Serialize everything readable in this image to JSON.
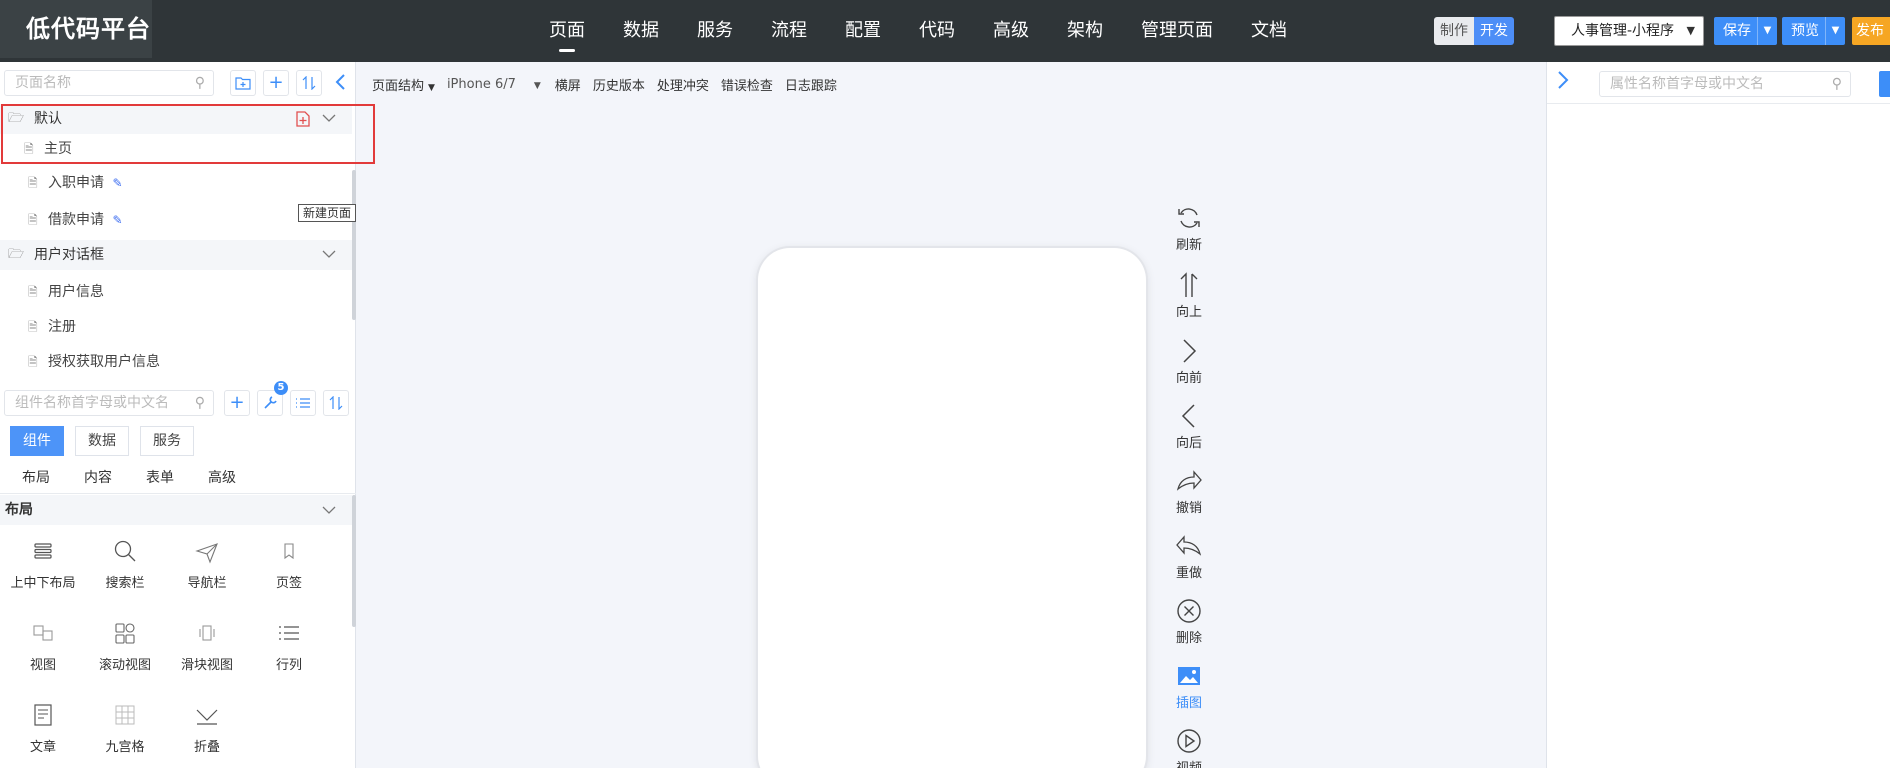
{
  "app": {
    "title": "低代码平台"
  },
  "main_nav": [
    {
      "label": "页面",
      "active": true
    },
    {
      "label": "数据"
    },
    {
      "label": "服务"
    },
    {
      "label": "流程"
    },
    {
      "label": "配置"
    },
    {
      "label": "代码"
    },
    {
      "label": "高级"
    },
    {
      "label": "架构"
    },
    {
      "label": "管理页面"
    },
    {
      "label": "文档"
    }
  ],
  "mode_toggle": {
    "make_label": "制作",
    "dev_label": "开发",
    "selected": "开发"
  },
  "project_select": {
    "value": "人事管理-小程序"
  },
  "actions": {
    "save": "保存",
    "preview": "预览",
    "publish": "发布"
  },
  "colors": {
    "topbar": "#2f3538",
    "accent": "#3d8ef8",
    "publish": "#f6a623",
    "highlight": "#e23a3a",
    "canvas_bg": "#f3f5fa"
  },
  "left": {
    "page_search": {
      "placeholder": "页面名称"
    },
    "tree": {
      "groups": [
        {
          "label": "默认",
          "items": [
            {
              "label": "主页"
            },
            {
              "label": "入职申请",
              "editable": true
            },
            {
              "label": "借款申请",
              "editable": true
            }
          ]
        },
        {
          "label": "用户对话框",
          "items": [
            {
              "label": "用户信息"
            },
            {
              "label": "注册"
            },
            {
              "label": "授权获取用户信息"
            }
          ]
        }
      ]
    },
    "tooltip": "新建页面",
    "component_search": {
      "placeholder": "组件名称首字母或中文名"
    },
    "tool_badge": "5",
    "comp_tabs": [
      {
        "label": "组件",
        "active": true
      },
      {
        "label": "数据"
      },
      {
        "label": "服务"
      }
    ],
    "categories": [
      "布局",
      "内容",
      "表单",
      "高级"
    ],
    "section": {
      "label": "布局"
    },
    "components": [
      {
        "label": "上中下布局",
        "icon": "layout-icon"
      },
      {
        "label": "搜索栏",
        "icon": "search-icon"
      },
      {
        "label": "导航栏",
        "icon": "navbar-icon"
      },
      {
        "label": "页签",
        "icon": "tag-icon"
      },
      {
        "label": "视图",
        "icon": "view-icon"
      },
      {
        "label": "滚动视图",
        "icon": "scroll-view-icon"
      },
      {
        "label": "滑块视图",
        "icon": "slider-view-icon"
      },
      {
        "label": "行列",
        "icon": "rows-icon"
      },
      {
        "label": "文章",
        "icon": "article-icon"
      },
      {
        "label": "九宫格",
        "icon": "grid-icon"
      },
      {
        "label": "折叠",
        "icon": "collapse-icon"
      }
    ]
  },
  "canvas_toolbar": {
    "structure": "页面结构",
    "device": "iPhone 6/7",
    "landscape": "横屏",
    "history": "历史版本",
    "conflict": "处理冲突",
    "error_check": "错误检查",
    "log": "日志跟踪"
  },
  "canvas_tools": [
    {
      "label": "刷新",
      "icon": "refresh-icon"
    },
    {
      "label": "向上",
      "icon": "arrow-up-icon"
    },
    {
      "label": "向前",
      "icon": "chevron-right-icon"
    },
    {
      "label": "向后",
      "icon": "chevron-left-icon"
    },
    {
      "label": "撤销",
      "icon": "undo-icon"
    },
    {
      "label": "重做",
      "icon": "redo-icon"
    },
    {
      "label": "删除",
      "icon": "delete-icon"
    },
    {
      "label": "插图",
      "icon": "image-icon",
      "active": true
    },
    {
      "label": "视频",
      "icon": "play-icon"
    }
  ],
  "right": {
    "property_search": {
      "placeholder": "属性名称首字母或中文名"
    }
  }
}
